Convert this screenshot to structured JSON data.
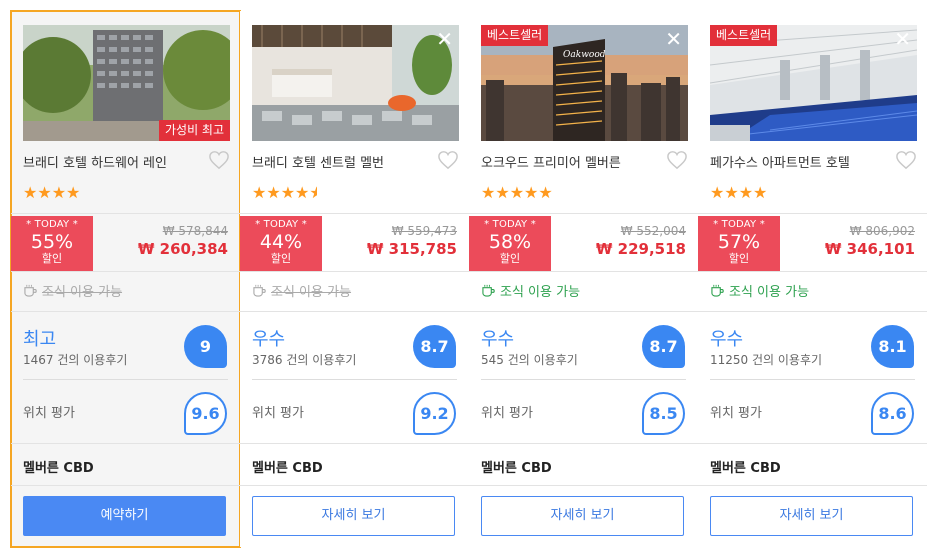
{
  "cards": [
    {
      "name": "브래디 호텔 하드웨어 레인",
      "badge": "가성비 최고",
      "badge_pos": "bottom",
      "stars": "★★★★",
      "today_label": "* TODAY *",
      "discount": "55%",
      "discount_suffix": "할인",
      "original_price": "₩ 578,844",
      "price": "₩ 260,384",
      "breakfast": "조식 이용 가능",
      "breakfast_available": false,
      "rating_word": "최고",
      "review_count": "1467 건의 이용후기",
      "score": "9",
      "location_label": "위치 평가",
      "location_score": "9.6",
      "area": "멜버른 CBD",
      "button": "예약하기",
      "close": "",
      "selected": true
    },
    {
      "name": "브래디 호텔 센트럴 멜번",
      "badge": "",
      "stars": "★★★★",
      "half_star": "★",
      "today_label": "* TODAY *",
      "discount": "44%",
      "discount_suffix": "할인",
      "original_price": "₩ 559,473",
      "price": "₩ 315,785",
      "breakfast": "조식 이용 가능",
      "breakfast_available": false,
      "rating_word": "우수",
      "review_count": "3786 건의 이용후기",
      "score": "8.7",
      "location_label": "위치 평가",
      "location_score": "9.2",
      "area": "멜버른 CBD",
      "button": "자세히 보기",
      "close": "✕",
      "selected": false
    },
    {
      "name": "오크우드 프리미어 멜버른",
      "badge": "베스트셀러",
      "badge_pos": "top",
      "stars": "★★★★★",
      "today_label": "* TODAY *",
      "discount": "58%",
      "discount_suffix": "할인",
      "original_price": "₩ 552,004",
      "price": "₩ 229,518",
      "breakfast": "조식 이용 가능",
      "breakfast_available": true,
      "rating_word": "우수",
      "review_count": "545 건의 이용후기",
      "score": "8.7",
      "location_label": "위치 평가",
      "location_score": "8.5",
      "area": "멜버른 CBD",
      "button": "자세히 보기",
      "close": "✕",
      "selected": false
    },
    {
      "name": "페가수스 아파트먼트 호텔",
      "badge": "베스트셀러",
      "badge_pos": "top",
      "stars": "★★★★",
      "today_label": "* TODAY *",
      "discount": "57%",
      "discount_suffix": "할인",
      "original_price": "₩ 806,902",
      "price": "₩ 346,101",
      "breakfast": "조식 이용 가능",
      "breakfast_available": true,
      "rating_word": "우수",
      "review_count": "11250 건의 이용후기",
      "score": "8.1",
      "location_label": "위치 평가",
      "location_score": "8.6",
      "area": "멜버른 CBD",
      "button": "자세히 보기",
      "close": "✕",
      "selected": false
    }
  ],
  "colors": {
    "accent_blue": "#3a87f2",
    "discount_red": "#ec4b5a",
    "price_red": "#e2303a",
    "star_orange": "#ff9a1f",
    "breakfast_green": "#2ea14f",
    "selected_border": "#f5a623"
  }
}
